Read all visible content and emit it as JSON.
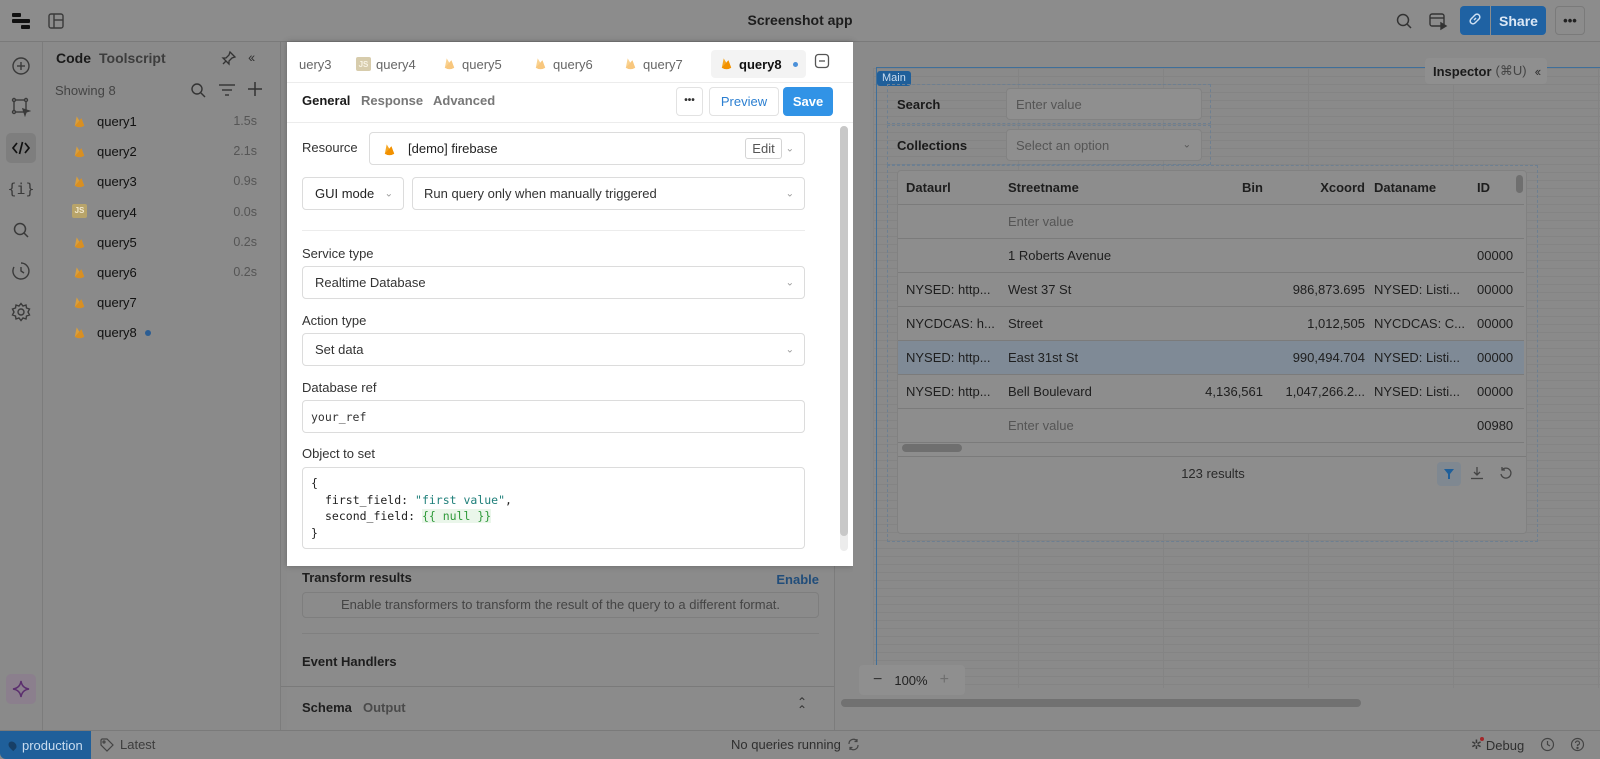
{
  "app": {
    "title": "Screenshot app"
  },
  "topbar": {
    "share_label": "Share",
    "accent": "#1f62a3"
  },
  "rail": {
    "items": [
      "add-icon",
      "select-component-icon",
      "code-icon",
      "state-icon",
      "search-icon",
      "history-icon",
      "settings-icon"
    ],
    "assistant": "sparkle-icon"
  },
  "code_panel": {
    "tabs": [
      "Code",
      "Toolscript"
    ],
    "showing": "Showing 8",
    "queries": [
      {
        "name": "query1",
        "type": "firebase",
        "time": "1.5s"
      },
      {
        "name": "query2",
        "type": "firebase",
        "time": "2.1s"
      },
      {
        "name": "query3",
        "type": "firebase",
        "time": "0.9s"
      },
      {
        "name": "query4",
        "type": "js",
        "time": "0.0s"
      },
      {
        "name": "query5",
        "type": "firebase",
        "time": "0.2s"
      },
      {
        "name": "query6",
        "type": "firebase",
        "time": "0.2s"
      },
      {
        "name": "query7",
        "type": "firebase",
        "time": ""
      },
      {
        "name": "query8",
        "type": "firebase",
        "time": "",
        "unsaved": true
      }
    ]
  },
  "editor": {
    "query_tabs": [
      {
        "name": "uery3",
        "type": "none"
      },
      {
        "name": "query4",
        "type": "js"
      },
      {
        "name": "query5",
        "type": "firebase"
      },
      {
        "name": "query6",
        "type": "firebase"
      },
      {
        "name": "query7",
        "type": "firebase"
      },
      {
        "name": "query8",
        "type": "firebase",
        "active": true
      }
    ],
    "js_label": "JS",
    "section_tabs": [
      "General",
      "Response",
      "Advanced"
    ],
    "more_label": "•••",
    "preview_label": "Preview",
    "save_label": "Save",
    "resource_label": "Resource",
    "resource_value": "[demo] firebase",
    "edit_label": "Edit",
    "mode_value": "GUI mode",
    "trigger_value": "Run query only when manually triggered",
    "service_type_label": "Service type",
    "service_type_value": "Realtime Database",
    "action_type_label": "Action type",
    "action_type_value": "Set data",
    "db_ref_label": "Database ref",
    "db_ref_value": "your_ref",
    "object_label": "Object to set",
    "code": {
      "open": "{",
      "line1_key": "first_field: ",
      "line1_val": "\"first value\"",
      "line1_end": ",",
      "line2_key": "second_field: ",
      "line2_val": "{{ null }}",
      "close": "}"
    },
    "transform_label": "Transform results",
    "enable_label": "Enable",
    "transform_hint": "Enable transformers to transform the result of the query to a different format.",
    "event_handlers_label": "Event Handlers",
    "bottom_tabs": [
      "Schema",
      "Output"
    ]
  },
  "canvas": {
    "inspector_label": "Inspector",
    "inspector_shortcut": "(⌘U)",
    "main_badge": "Main",
    "search_label": "Search",
    "search_placeholder": "Enter value",
    "collections_label": "Collections",
    "collections_placeholder": "Select an option",
    "table": {
      "columns": [
        "Dataurl",
        "Streetname",
        "Bin",
        "Xcoord",
        "Dataname",
        "ID"
      ],
      "rows": [
        [
          "",
          "Enter value",
          "",
          "",
          "",
          ""
        ],
        [
          "",
          "1 Roberts Avenue",
          "",
          "",
          "",
          "00000"
        ],
        [
          "NYSED: http...",
          "West 37 St",
          "",
          "986,873.695",
          "NYSED: Listi...",
          "00000"
        ],
        [
          "NYCDCAS: h...",
          "Street",
          "",
          "1,012,505",
          "NYCDCAS: C...",
          "00000"
        ],
        [
          "NYSED: http...",
          "East 31st St",
          "",
          "990,494.704",
          "NYSED: Listi...",
          "00000"
        ],
        [
          "NYSED: http...",
          "Bell Boulevard",
          "4,136,561",
          "1,047,266.2...",
          "NYSED: Listi...",
          "00000"
        ],
        [
          "",
          "Enter value",
          "",
          "",
          "",
          "00980"
        ]
      ],
      "selected_row": 4,
      "results": "123 results"
    },
    "zoom": "100%"
  },
  "status": {
    "env": "production",
    "version": "Latest",
    "queries": "No queries running",
    "debug": "Debug"
  }
}
